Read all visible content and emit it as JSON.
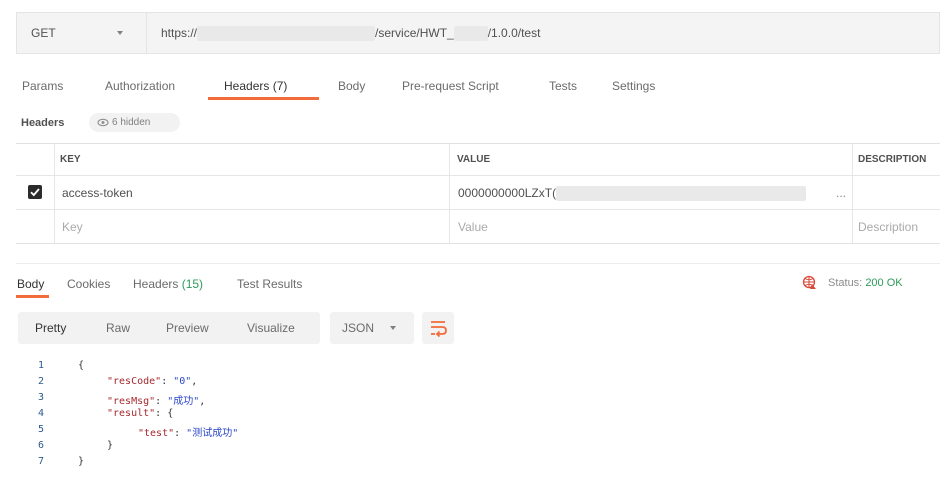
{
  "request": {
    "method": "GET",
    "url_prefix": "https://",
    "url_suffix": "/service/HWT_",
    "url_tail": "/1.0.0/test"
  },
  "request_tabs": {
    "params": "Params",
    "authorization": "Authorization",
    "headers": "Headers (7)",
    "body": "Body",
    "prerequest": "Pre-request Script",
    "tests": "Tests",
    "settings": "Settings"
  },
  "headers_section": {
    "title": "Headers",
    "hidden_label": "6 hidden"
  },
  "headers_table": {
    "columns": {
      "key": "KEY",
      "value": "VALUE",
      "description": "DESCRIPTION"
    },
    "row": {
      "key": "access-token",
      "value": "0000000000LZxT(",
      "ellipsis": "..."
    },
    "placeholder": {
      "key": "Key",
      "value": "Value",
      "description": "Description"
    }
  },
  "response_tabs": {
    "body": "Body",
    "cookies": "Cookies",
    "headers": "Headers",
    "headers_count": "(15)",
    "test_results": "Test Results"
  },
  "status": {
    "label": "Status:",
    "value": "200 OK"
  },
  "view_modes": {
    "pretty": "Pretty",
    "raw": "Raw",
    "preview": "Preview",
    "visualize": "Visualize"
  },
  "format": "JSON",
  "code": {
    "line_numbers": [
      "1",
      "2",
      "3",
      "4",
      "5",
      "6",
      "7"
    ],
    "l1": "{",
    "l2_key": "\"resCode\"",
    "l2_val": "\"0\"",
    "l3_key": "\"resMsg\"",
    "l3_val": "\"成功\"",
    "l4_key": "\"result\"",
    "l4_punct": ": {",
    "l5_key": "\"test\"",
    "l5_val": "\"测试成功\"",
    "l6": "}",
    "l7": "}"
  },
  "colors": {
    "accent": "#f26b3a",
    "success": "#2e9b5a"
  }
}
